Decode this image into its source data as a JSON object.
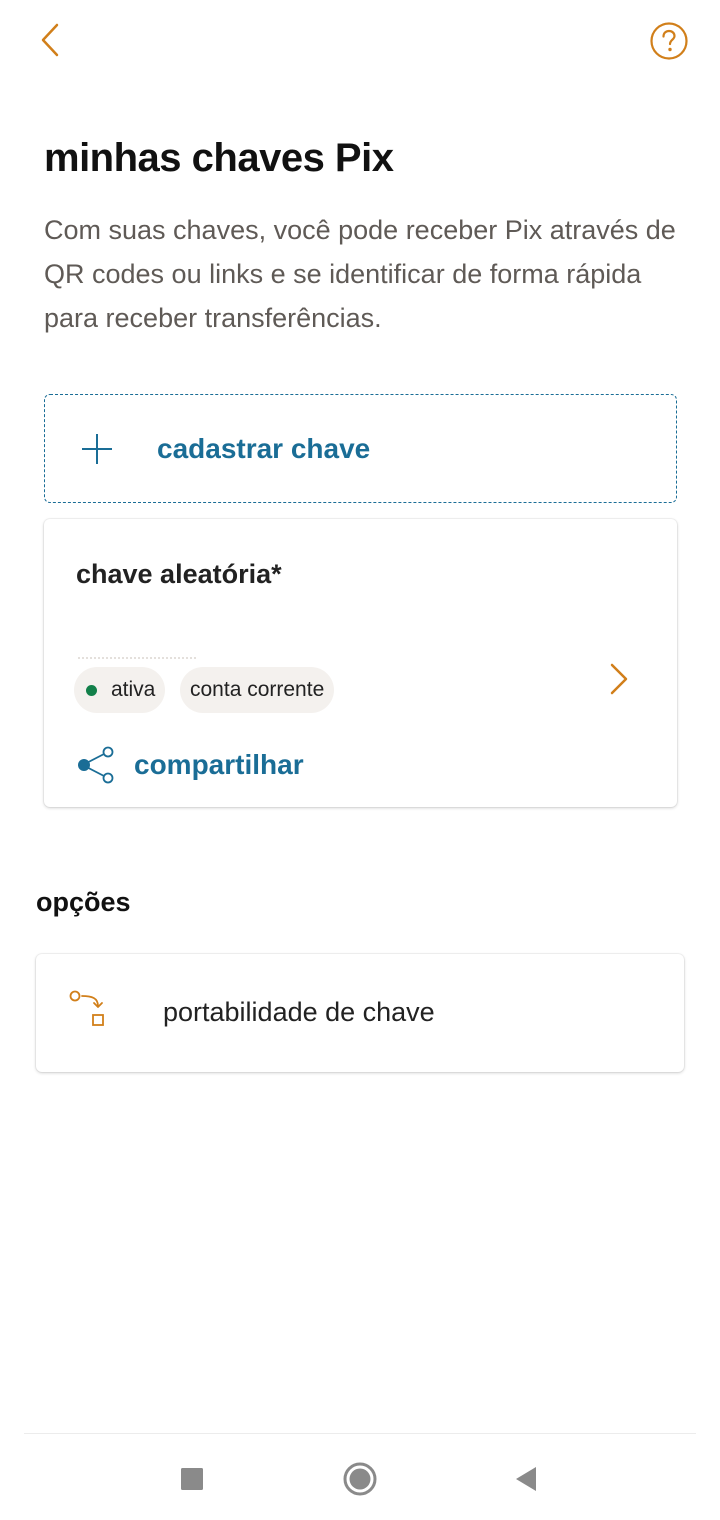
{
  "header": {
    "back_icon": "chevron-left-icon",
    "help_icon": "question-circle-icon"
  },
  "page": {
    "title": "minhas chaves Pix",
    "description": "Com suas chaves, você pode receber Pix através de QR codes ou links e se identificar de forma rápida para receber transferências."
  },
  "add_key": {
    "label": "cadastrar chave",
    "icon": "plus-icon"
  },
  "key_card": {
    "title": "chave aleatória*",
    "status_label": "ativa",
    "status_color": "#12804a",
    "account_label": "conta corrente",
    "share_label": "compartilhar",
    "share_icon": "share-icon",
    "chevron_icon": "chevron-right-icon"
  },
  "options": {
    "section_title": "opções",
    "items": [
      {
        "label": "portabilidade de chave",
        "icon": "key-portability-icon"
      }
    ]
  },
  "colors": {
    "accent_orange": "#d17f1a",
    "link_blue": "#1a6d96",
    "text_muted": "#5f5a56"
  },
  "system_nav": {
    "recents_icon": "square-icon",
    "home_icon": "circle-icon",
    "back_icon": "triangle-back-icon"
  }
}
